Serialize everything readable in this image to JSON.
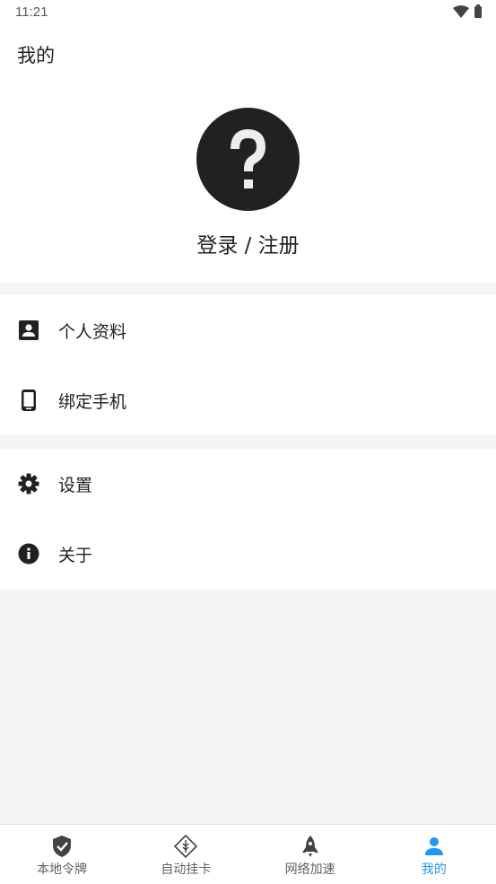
{
  "status_bar": {
    "time": "11:21"
  },
  "header": {
    "title": "我的"
  },
  "profile": {
    "login_label": "登录 / 注册",
    "avatar_icon": "question-icon"
  },
  "menu_groups": [
    {
      "items": [
        {
          "label": "个人资料",
          "icon": "profile-card-icon"
        },
        {
          "label": "绑定手机",
          "icon": "phone-icon"
        }
      ]
    },
    {
      "items": [
        {
          "label": "设置",
          "icon": "gear-icon"
        },
        {
          "label": "关于",
          "icon": "info-icon"
        }
      ]
    }
  ],
  "bottom_nav": {
    "items": [
      {
        "label": "本地令牌",
        "icon": "shield-check-icon"
      },
      {
        "label": "自动挂卡",
        "icon": "card-diamond-icon"
      },
      {
        "label": "网络加速",
        "icon": "rocket-icon"
      },
      {
        "label": "我的",
        "icon": "person-icon",
        "active": true
      }
    ]
  },
  "colors": {
    "accent": "#2196f3",
    "text": "#212121",
    "background": "#f5f5f5"
  }
}
